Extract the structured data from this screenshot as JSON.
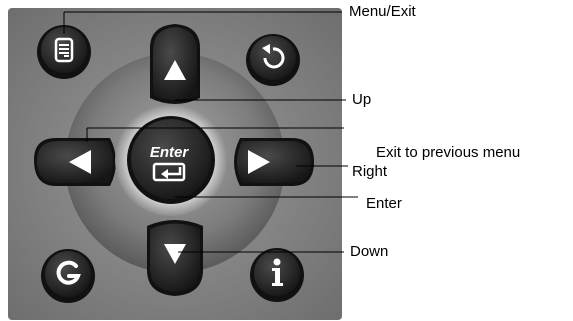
{
  "labels": {
    "menu_exit": "Menu/Exit",
    "up": "Up",
    "exit_prev": "Exit to previous menu",
    "right": "Right",
    "enter": "Enter",
    "down": "Down"
  },
  "buttons": {
    "enter_text": "Enter"
  },
  "icons": {
    "menu": "menu-icon",
    "back": "refresh-back-icon",
    "g": "g-icon",
    "info": "info-icon",
    "enter": "enter-return-icon"
  },
  "colors": {
    "panel": "#8a8a8a",
    "button": "#2a2a2a",
    "ring": "#b8b8b8"
  }
}
